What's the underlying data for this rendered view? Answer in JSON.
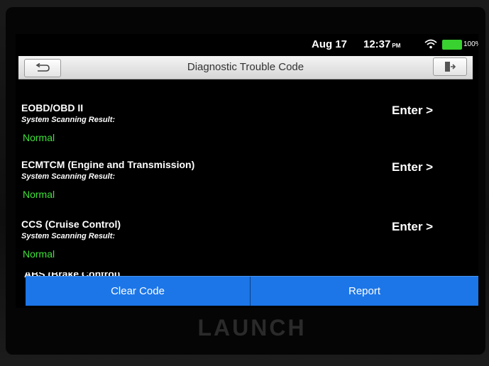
{
  "status_bar": {
    "date": "Aug 17",
    "time": "12:37",
    "ampm": "PM",
    "battery_pct": "100%",
    "wifi_icon": "wifi-icon",
    "battery_icon": "battery-icon",
    "battery_color": "#38d12f"
  },
  "header": {
    "title": "Diagnostic Trouble Code",
    "back_icon": "back-arrow-icon",
    "exit_icon": "exit-icon"
  },
  "systems": [
    {
      "name": "EOBD/OBD II",
      "scan_label": "System Scanning Result:",
      "result": "Normal",
      "enter": "Enter >"
    },
    {
      "name": "ECMTCM (Engine and Transmission)",
      "scan_label": "System Scanning Result:",
      "result": "Normal",
      "enter": "Enter >"
    },
    {
      "name": "CCS (Cruise Control)",
      "scan_label": "System Scanning Result:",
      "result": "Normal",
      "enter": "Enter >"
    }
  ],
  "partial_item": "ABS (Brake Control)",
  "footer": {
    "clear_code": "Clear Code",
    "report": "Report",
    "accent": "#1c76e8"
  },
  "device": {
    "brand": "LAUNCH"
  },
  "colors": {
    "normal_green": "#3fe13a"
  }
}
